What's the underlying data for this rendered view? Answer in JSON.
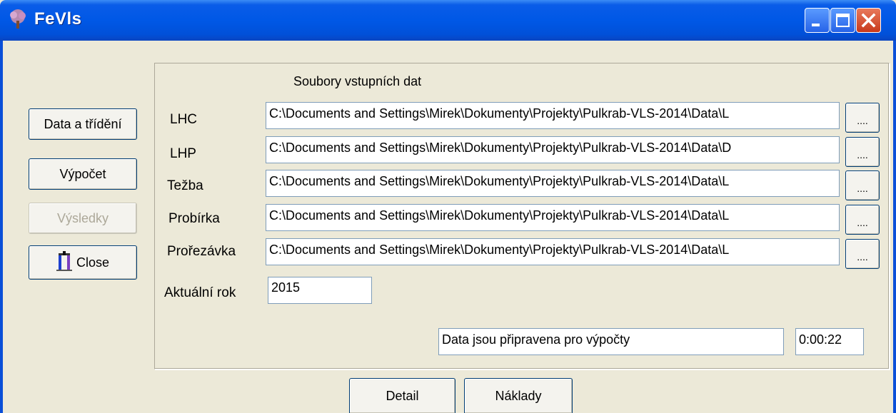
{
  "window": {
    "title": "FeVls"
  },
  "sidebar": {
    "data_button": "Data a třídění",
    "calc_button": "Výpočet",
    "results_button": "Výsledky",
    "close_button": "Close"
  },
  "group": {
    "caption": "Soubory vstupních dat"
  },
  "files": [
    {
      "label": "LHC",
      "value": "C:\\Documents and Settings\\Mirek\\Dokumenty\\Projekty\\Pulkrab-VLS-2014\\Data\\L",
      "browse": "...."
    },
    {
      "label": "LHP",
      "value": "C:\\Documents and Settings\\Mirek\\Dokumenty\\Projekty\\Pulkrab-VLS-2014\\Data\\D",
      "browse": "...."
    },
    {
      "label": "Težba",
      "value": "C:\\Documents and Settings\\Mirek\\Dokumenty\\Projekty\\Pulkrab-VLS-2014\\Data\\L",
      "browse": "...."
    },
    {
      "label": "Probírka",
      "value": "C:\\Documents and Settings\\Mirek\\Dokumenty\\Projekty\\Pulkrab-VLS-2014\\Data\\L",
      "browse": "...."
    },
    {
      "label": "Prořezávka",
      "value": "C:\\Documents and Settings\\Mirek\\Dokumenty\\Projekty\\Pulkrab-VLS-2014\\Data\\L",
      "browse": "...."
    }
  ],
  "year": {
    "label": "Aktuální rok",
    "value": "2015"
  },
  "status": {
    "message": "Data jsou připravena pro výpočty",
    "time": "0:00:22"
  },
  "footer": {
    "detail_button": "Detail",
    "costs_button": "Náklady"
  }
}
